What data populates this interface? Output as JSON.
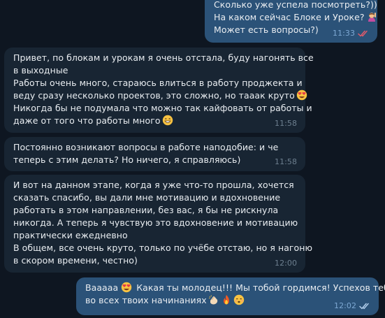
{
  "messages": [
    {
      "id": "msg-1",
      "direction": "outgoing",
      "lines": [
        "Сколько уже успела посмотреть?))",
        "На каком сейчас Блоке и Уроке?",
        "Может есть вопросы?)"
      ],
      "time": "11:33",
      "status": "read"
    },
    {
      "id": "msg-2",
      "direction": "incoming",
      "lines": [
        "Привет, по блокам и урокам я очень отстала, буду нагонять все",
        "в выходные",
        "Работы очень много, стараюсь влиться в работу проджекта и",
        "веду сразу несколько проектов, это сложно, но тааак круто",
        "Никогда бы не подумала что можно так кайфовать от работы и",
        "даже от того что работы много"
      ],
      "time": "11:58"
    },
    {
      "id": "msg-3",
      "direction": "incoming",
      "lines": [
        "Постоянно возникают вопросы в работе наподобие: и че",
        "теперь с этим делать? Но ничего, я справляюсь)"
      ],
      "time": "11:58"
    },
    {
      "id": "msg-4",
      "direction": "incoming",
      "lines": [
        "И вот на данном этапе, когда я уже что-то прошла, хочется",
        "сказать спасибо, вы дали мне мотивацию и вдохновение",
        "работать в этом направлении, без вас, я бы не рискнула",
        "никогда. А теперь я чувствую это вдохновение и мотивацию",
        "практически ежедневно",
        "В общем, все очень круто, только по учёбе отстаю, но я нагоню",
        "в скором времени, честно)"
      ],
      "time": "12:00"
    },
    {
      "id": "msg-5",
      "direction": "outgoing",
      "lines": [
        "Вааааа",
        "Какая ты молодец!!! Мы тобой гордимся! Успехов тебе",
        "во всех твоих начинаниях"
      ],
      "time": "12:02",
      "status": "read"
    }
  ],
  "emojis": {
    "msg1_line2": "woman-raising-hand-emoji",
    "msg2_line4": "smiling-face-with-heart-eyes-emoji",
    "msg2_line6": "grinning-face-emoji",
    "msg5_line1": "smiling-face-with-heart-eyes-emoji",
    "msg5_line3": [
      "clapping-hands-emoji",
      "fire-emoji",
      "smirking-face-emoji"
    ]
  },
  "colors": {
    "background": "#0e1621",
    "incoming_bubble": "#182533",
    "outgoing_bubble": "#2b5278",
    "text": "#e9edf1",
    "read_ticks": "#b0cdeb",
    "unread_ticks": "#e05b6b"
  }
}
